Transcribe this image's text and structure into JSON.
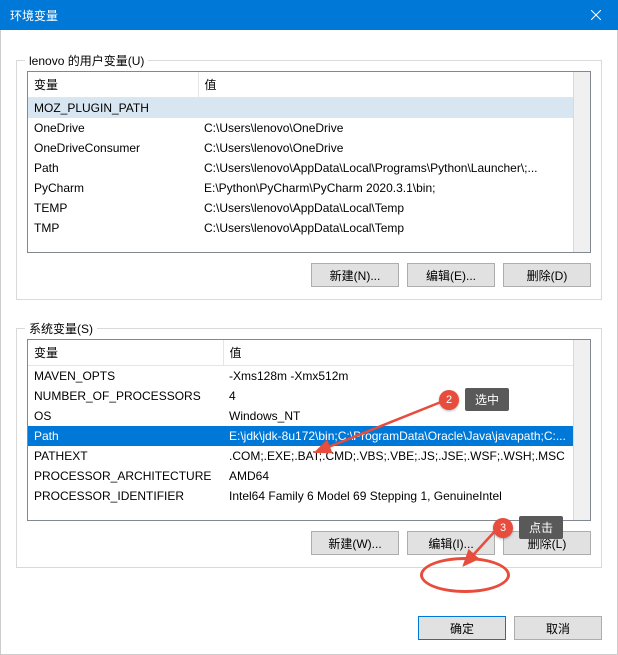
{
  "window": {
    "title": "环境变量",
    "close_icon": "close"
  },
  "user_vars": {
    "label": "lenovo 的用户变量(U)",
    "col_var": "变量",
    "col_val": "值",
    "rows": [
      {
        "var": "MOZ_PLUGIN_PATH",
        "val": ""
      },
      {
        "var": "OneDrive",
        "val": "C:\\Users\\lenovo\\OneDrive"
      },
      {
        "var": "OneDriveConsumer",
        "val": "C:\\Users\\lenovo\\OneDrive"
      },
      {
        "var": "Path",
        "val": "C:\\Users\\lenovo\\AppData\\Local\\Programs\\Python\\Launcher\\;..."
      },
      {
        "var": "PyCharm",
        "val": "E:\\Python\\PyCharm\\PyCharm 2020.3.1\\bin;"
      },
      {
        "var": "TEMP",
        "val": "C:\\Users\\lenovo\\AppData\\Local\\Temp"
      },
      {
        "var": "TMP",
        "val": "C:\\Users\\lenovo\\AppData\\Local\\Temp"
      }
    ],
    "btn_new": "新建(N)...",
    "btn_edit": "编辑(E)...",
    "btn_del": "删除(D)"
  },
  "sys_vars": {
    "label": "系统变量(S)",
    "col_var": "变量",
    "col_val": "值",
    "rows": [
      {
        "var": "MAVEN_OPTS",
        "val": "-Xms128m -Xmx512m"
      },
      {
        "var": "NUMBER_OF_PROCESSORS",
        "val": "4"
      },
      {
        "var": "OS",
        "val": "Windows_NT"
      },
      {
        "var": "Path",
        "val": "E:\\jdk\\jdk-8u172\\bin;C:\\ProgramData\\Oracle\\Java\\javapath;C:..."
      },
      {
        "var": "PATHEXT",
        "val": ".COM;.EXE;.BAT;.CMD;.VBS;.VBE;.JS;.JSE;.WSF;.WSH;.MSC"
      },
      {
        "var": "PROCESSOR_ARCHITECTURE",
        "val": "AMD64"
      },
      {
        "var": "PROCESSOR_IDENTIFIER",
        "val": "Intel64 Family 6 Model 69 Stepping 1, GenuineIntel"
      }
    ],
    "selected_index": 3,
    "btn_new": "新建(W)...",
    "btn_edit": "编辑(I)...",
    "btn_del": "删除(L)"
  },
  "footer": {
    "ok": "确定",
    "cancel": "取消"
  },
  "annotations": {
    "badge2": "2",
    "tag2": "选中",
    "badge3": "3",
    "tag3": "点击"
  }
}
